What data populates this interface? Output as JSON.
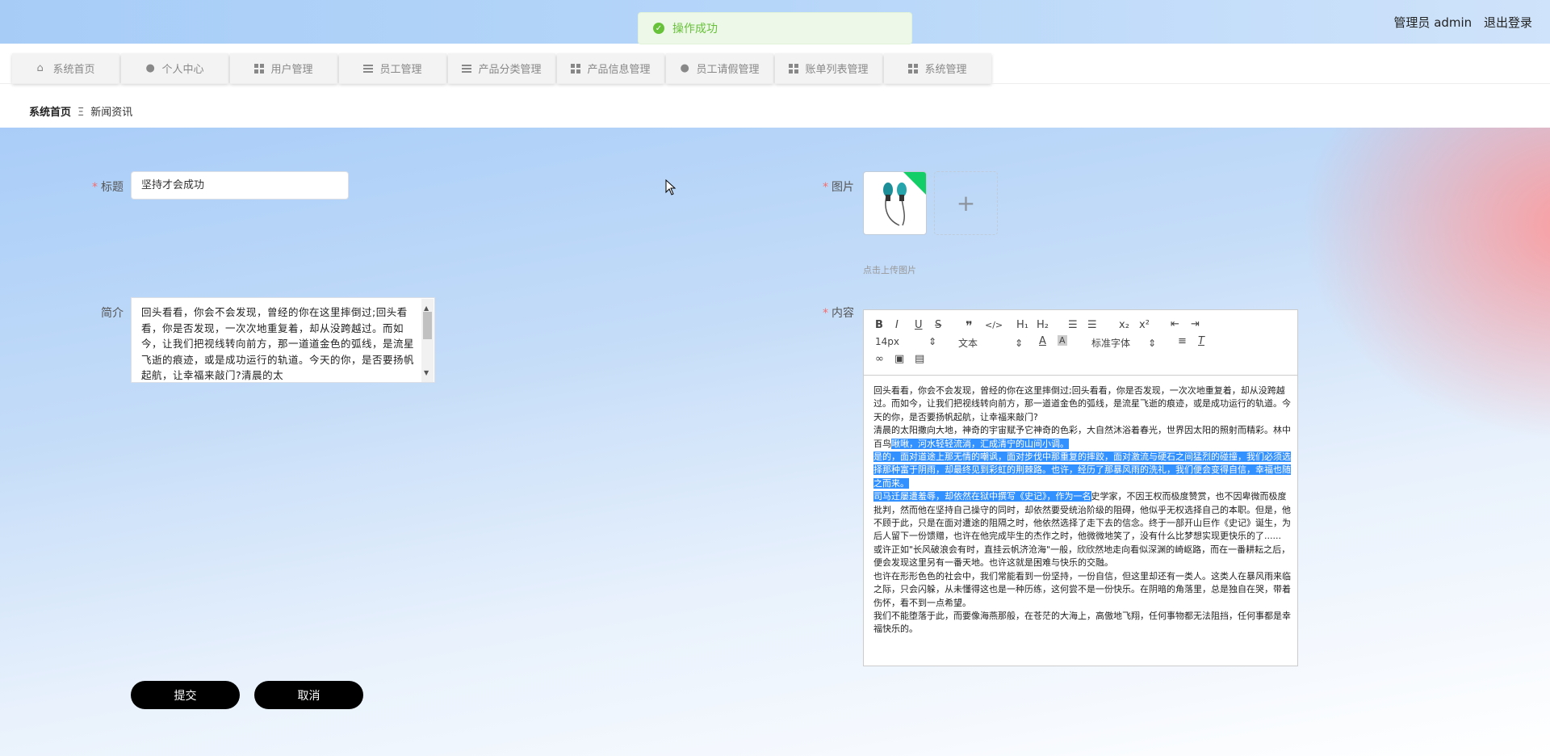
{
  "header": {
    "user": "管理员 admin",
    "logout": "退出登录"
  },
  "toast": {
    "message": "操作成功",
    "color": "#67c23a"
  },
  "nav": [
    {
      "label": "系统首页",
      "icon": "home-icon"
    },
    {
      "label": "个人中心",
      "icon": "user-icon"
    },
    {
      "label": "用户管理",
      "icon": "grid-icon"
    },
    {
      "label": "员工管理",
      "icon": "list-icon"
    },
    {
      "label": "产品分类管理",
      "icon": "sliders-icon"
    },
    {
      "label": "产品信息管理",
      "icon": "grid-icon"
    },
    {
      "label": "员工请假管理",
      "icon": "user-icon"
    },
    {
      "label": "账单列表管理",
      "icon": "grid-icon"
    },
    {
      "label": "系统管理",
      "icon": "grid-icon"
    }
  ],
  "breadcrumb": {
    "home": "系统首页",
    "separator": "Ξ",
    "current": "新闻资讯"
  },
  "form": {
    "title_label": "标题",
    "title_value": "坚持才会成功",
    "intro_label": "简介",
    "intro_value": "回头看看，你会不会发现，曾经的你在这里摔倒过;回头看看，你是否发现，一次次地重复着，却从没跨越过。而如今，让我们把视线转向前方，那一道道金色的弧线，是流星飞逝的痕迹，或是成功运行的轨道。今天的你，是否要扬帆起航，让幸福来敲门?清晨的太",
    "image_label": "图片",
    "image_icon": "earphones-image",
    "upload_plus": "+",
    "upload_hint": "点击上传图片",
    "content_label": "内容",
    "required_mark": "*"
  },
  "editor": {
    "toolbar": {
      "bold": "B",
      "italic": "I",
      "underline": "U",
      "strike": "S",
      "quote": "❞",
      "code": "</>",
      "h1": "H₁",
      "h2": "H₂",
      "ordered_list": "☰",
      "bullet_list": "☰",
      "sub": "x₂",
      "sup": "x²",
      "outdent": "⇤",
      "indent": "⇥",
      "font_size": "14px",
      "header_select": "文本",
      "font_family": "标准字体",
      "link_icon": "link-icon",
      "image_icon": "image-icon",
      "video_icon": "video-icon"
    },
    "paragraphs": [
      {
        "segments": [
          {
            "text": "回头看看，你会不会发现，曾经的你在这里摔倒过;回头看看，你是否发现，一次次地重复着，却从没跨越过。而如今，让我们把视线转向前方，那一道道金色的弧线，是流星飞逝的痕迹，或是成功运行的轨道。今天的你，是否要扬帆起航，让幸福来敲门?",
            "hl": false
          }
        ]
      },
      {
        "segments": [
          {
            "text": "清晨的太阳撒向大地，神奇的宇宙赋予它神奇的色彩，大自然沐浴着春光，世界因太阳的照射而精彩。林中百鸟",
            "hl": false
          },
          {
            "text": "啾啾，河水轻轻流淌，汇成清宁的山间小调。",
            "hl": true
          }
        ]
      },
      {
        "segments": [
          {
            "text": "是的，面对道途上那无情的嘲讽，面对步伐中那重复的摔跤，面对激流与硬石之间猛烈的碰撞，我们必须选择那种富于阴雨，却最终见到彩虹的荆棘路。也许，经历了那暴风雨的洗礼，我们便会变得自信，幸福也随之而来。",
            "hl": true
          }
        ]
      },
      {
        "segments": [
          {
            "text": "司马迁屡遭羞辱，却依然在狱中撰写《史记》，作为一名",
            "hl": true
          },
          {
            "text": "史学家，不因王权而极度赞赏，也不因卑微而极度批判，然而他在坚持自己操守的同时，却依然要受统治阶级的阻碍，他似乎无权选择自己的本职。但是，他不顾于此，只是在面对遭途的阻隔之时，他依然选择了走下去的信念。终于一部开山巨作《史记》诞生，为后人留下一份馈赠，也许在他完成毕生的杰作之时，他微微地笑了，没有什么比梦想实现更快乐的了......",
            "hl": false
          }
        ]
      },
      {
        "segments": [
          {
            "text": "或许正如\"长风破浪会有时，直挂云帆济沧海\"一般，欣欣然地走向看似深渊的崎岖路，而在一番耕耘之后，便会发现这里另有一番天地。也许这就是困难与快乐的交融。",
            "hl": false
          }
        ]
      },
      {
        "segments": [
          {
            "text": "也许在形形色色的社会中，我们常能看到一份坚持，一份自信，但这里却还有一类人。这类人在暴风雨来临之际，只会闪躲，从未懂得这也是一种历练，这何尝不是一份快乐。在阴暗的角落里，总是独自在哭，带着伤怀，看不到一点希望。",
            "hl": false
          }
        ]
      },
      {
        "segments": [
          {
            "text": "我们不能堕落于此，而要像海燕那般，在苍茫的大海上，高傲地飞翔，任何事物都无法阻挡，任何事都是幸福快乐的。",
            "hl": false
          }
        ]
      }
    ]
  },
  "buttons": {
    "submit": "提交",
    "cancel": "取消"
  }
}
